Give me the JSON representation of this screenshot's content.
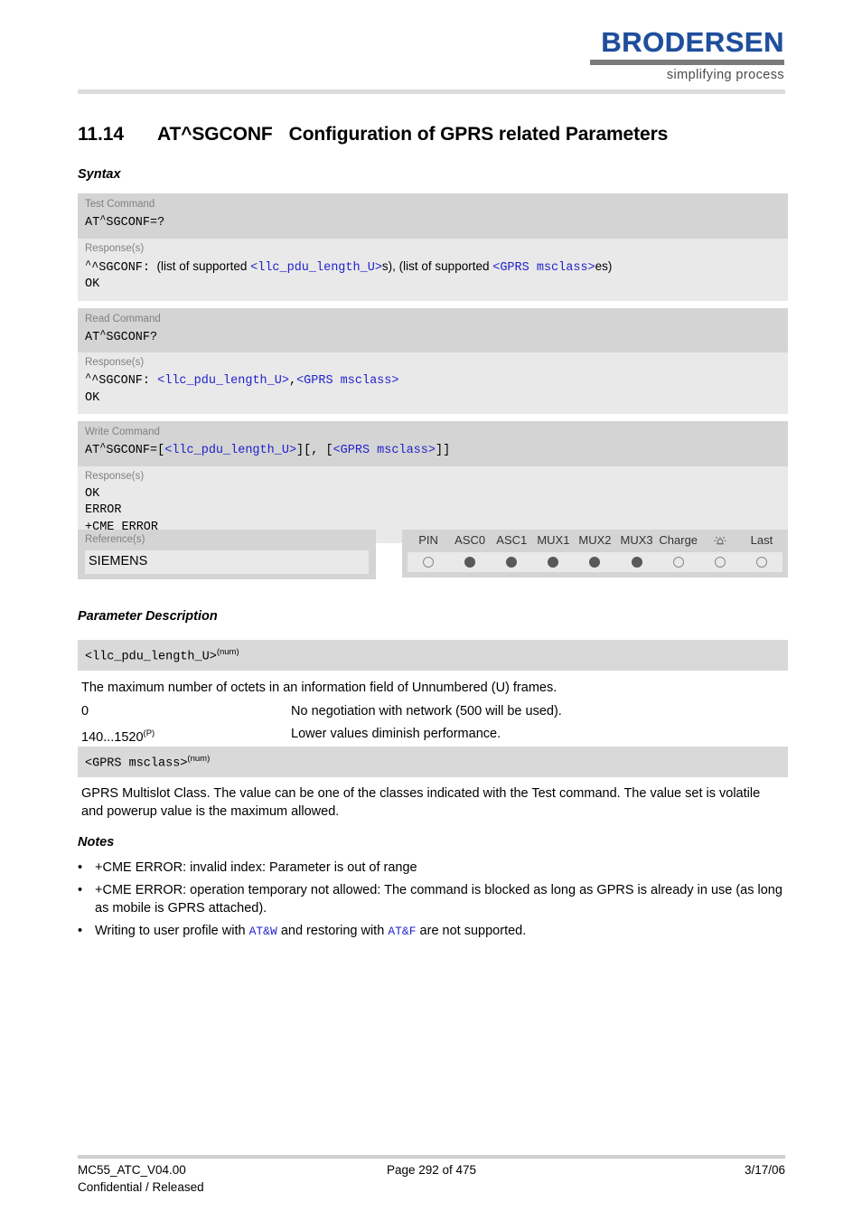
{
  "brand": {
    "name": "BRODERSEN",
    "tagline": "simplifying process"
  },
  "title": {
    "number": "11.14",
    "command": "AT^SGCONF",
    "text": "Configuration of GPRS related Parameters"
  },
  "headings": {
    "syntax": "Syntax",
    "parameter_description": "Parameter Description",
    "notes": "Notes"
  },
  "syntax": {
    "test": {
      "command_label": "Test Command",
      "command": "AT^SGCONF=?",
      "response_label": "Response(s)",
      "response_prefix": "^SGCONF:",
      "response_text_1": "(list of supported ",
      "response_param_1": "<llc_pdu_length_U>",
      "response_text_2": "s), (list of supported ",
      "response_param_2": "<GPRS msclass>",
      "response_text_3": "es)",
      "response_ok": "OK"
    },
    "read": {
      "command_label": "Read Command",
      "command": "AT^SGCONF?",
      "response_label": "Response(s)",
      "response_prefix": "^SGCONF:",
      "response_param_1": "<llc_pdu_length_U>",
      "response_sep": ",",
      "response_param_2": "<GPRS msclass>",
      "response_ok": "OK"
    },
    "write": {
      "command_label": "Write Command",
      "command_prefix": "AT^SGCONF=[",
      "command_param_1": "<llc_pdu_length_U>",
      "command_mid": "][, [",
      "command_param_2": "<GPRS msclass>",
      "command_suffix": "]]",
      "response_label": "Response(s)",
      "responses": [
        "OK",
        "ERROR",
        "+CME ERROR"
      ]
    }
  },
  "reference": {
    "label": "Reference(s)",
    "value": "SIEMENS"
  },
  "pin_table": {
    "columns": [
      "PIN",
      "ASC0",
      "ASC1",
      "MUX1",
      "MUX2",
      "MUX3",
      "Charge",
      "alarm-bell-icon",
      "Last"
    ],
    "states": [
      "off",
      "on",
      "on",
      "on",
      "on",
      "on",
      "off",
      "off",
      "off"
    ]
  },
  "parameters": [
    {
      "name": "<llc_pdu_length_U>",
      "type": "(num)",
      "description": "The maximum number of octets in an information field of Unnumbered (U) frames.",
      "values": [
        {
          "value": "0",
          "sup": "",
          "meaning": "No negotiation with network (500 will be used)."
        },
        {
          "value": "140...1520",
          "sup": "(P)",
          "meaning": "Lower values diminish performance."
        }
      ]
    },
    {
      "name": "<GPRS msclass>",
      "type": "(num)",
      "description": "GPRS Multislot Class. The value can be one of the classes indicated with the Test command. The value set is volatile and powerup value is the maximum allowed."
    }
  ],
  "notes": {
    "bullet": "•",
    "items": [
      {
        "text_1": "+CME ERROR: invalid index: Parameter is out of range",
        "code_1": "",
        "text_2": "",
        "code_2": "",
        "text_3": ""
      },
      {
        "text_1": "+CME ERROR: operation temporary not allowed: The command is blocked as long as GPRS is already in use (as long as mobile is GPRS attached).",
        "code_1": "",
        "text_2": "",
        "code_2": "",
        "text_3": ""
      },
      {
        "text_1": "Writing to user profile with ",
        "code_1": "AT&W",
        "text_2": " and restoring with ",
        "code_2": "AT&F",
        "text_3": " are not supported."
      }
    ]
  },
  "footer": {
    "document": "MC55_ATC_V04.00",
    "classification": "Confidential / Released",
    "page": "Page 292 of 475",
    "date": "3/17/06"
  },
  "colors": {
    "brand_blue": "#1f4e9c",
    "code_blue": "#2222cc",
    "band_dark": "#d4d4d4",
    "band_light": "#e9e9e9"
  }
}
